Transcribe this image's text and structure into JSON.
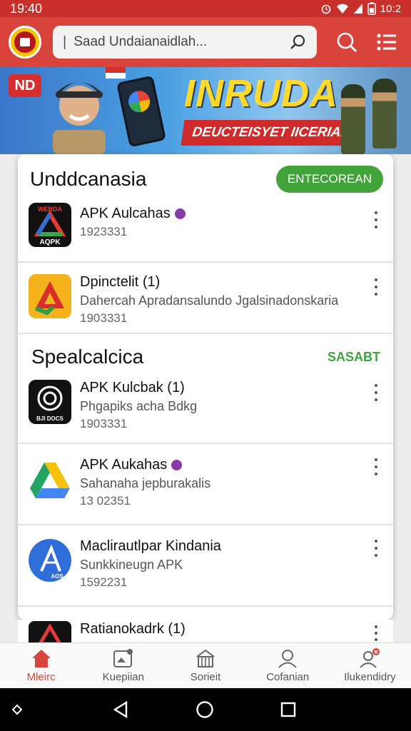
{
  "status_bar": {
    "time": "19:40",
    "right_time": "10:2"
  },
  "app_bar": {
    "search_placeholder": "Saad Undaianaidlah..."
  },
  "banner": {
    "badge": "ND",
    "headline": "INRUDA",
    "subline": "DEUCTEISYET IICERIAIA"
  },
  "section1": {
    "title": "Unddcanasia",
    "action_label": "ENTECOREAN",
    "apps": [
      {
        "name": "APK Aulcahas",
        "desc": "",
        "num": "1923331",
        "icon": "apk-triangle-black-icon",
        "badge": true,
        "icon_caption": "AQPK",
        "icon_top": "WEBDA"
      },
      {
        "name": "Dpinctelit (1)",
        "desc": "Dahercah Apradansalundo Jgalsinadonskaria",
        "num": "1903331",
        "icon": "apk-a-orange-icon",
        "badge": false
      }
    ]
  },
  "section2": {
    "title": "Spealcalcica",
    "action_label": "SASABT",
    "apps": [
      {
        "name": "APK Kulcbak (1)",
        "desc": "Phgapiks acha Bdkg",
        "num": "1903331",
        "icon": "camera-ring-icon",
        "badge": false,
        "icon_caption": "BJI DOCS"
      },
      {
        "name": "APK Aukahas",
        "desc": "Sahanaha jepburakalis",
        "num": "13 02351",
        "icon": "drive-triangle-icon",
        "badge": true
      },
      {
        "name": "Maclirautlpar Kindania",
        "desc": "Sunkkineugn APK",
        "num": "1592231",
        "icon": "blue-circle-a-icon",
        "badge": false,
        "icon_caption": "AOS"
      }
    ]
  },
  "peek_app": {
    "name": "Ratianokadrk (1)"
  },
  "bottom_nav": [
    {
      "label": "Mleirc",
      "icon": "home-icon",
      "active": true
    },
    {
      "label": "Kuepiian",
      "icon": "gallery-icon",
      "active": false
    },
    {
      "label": "Sorieit",
      "icon": "store-icon",
      "active": false
    },
    {
      "label": "Cofanian",
      "icon": "person-icon",
      "active": false
    },
    {
      "label": "Ilukendidry",
      "icon": "profile-badge-icon",
      "active": false
    }
  ],
  "colors": {
    "primary": "#d8433b",
    "accent_green": "#43a33b",
    "badge_purple": "#8a3aa8"
  }
}
